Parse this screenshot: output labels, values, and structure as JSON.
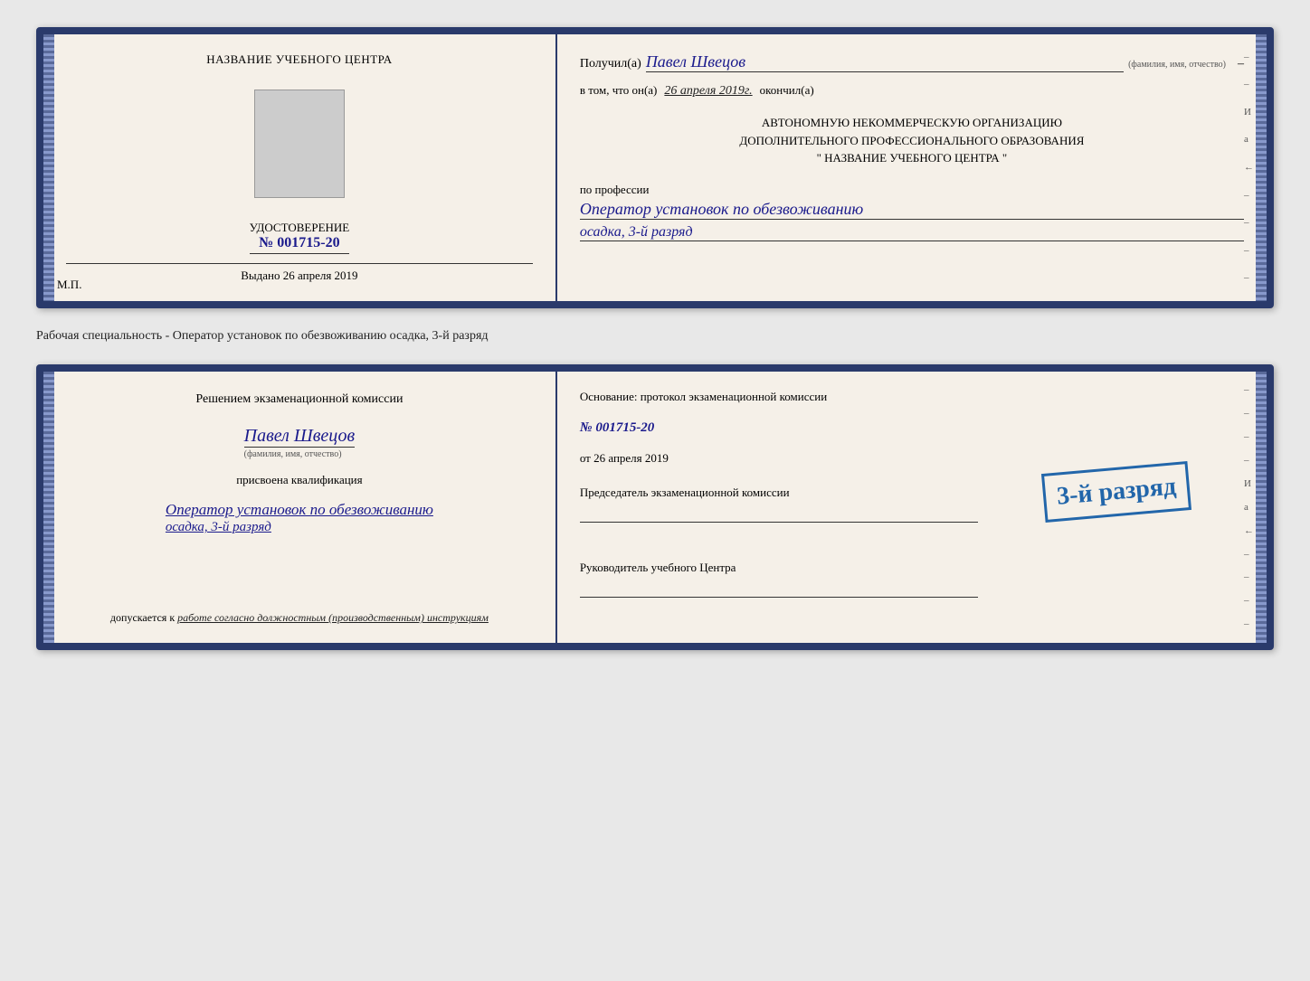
{
  "page": {
    "background": "#e8e8e8"
  },
  "top_document": {
    "left": {
      "title": "НАЗВАНИЕ УЧЕБНОГО ЦЕНТРА",
      "cert_label": "УДОСТОВЕРЕНИЕ",
      "cert_number_prefix": "№",
      "cert_number": "001715-20",
      "issued_label": "Выдано",
      "issued_date": "26 апреля 2019",
      "mp_label": "М.П."
    },
    "right": {
      "received_label": "Получил(а)",
      "recipient_name": "Павел Швецов",
      "fio_label": "(фамилия, имя, отчество)",
      "dash": "–",
      "in_that_label": "в том, что он(а)",
      "completion_date": "26 апреля 2019г.",
      "finished_label": "окончил(а)",
      "org_line1": "АВТОНОМНУЮ НЕКОММЕРЧЕСКУЮ ОРГАНИЗАЦИЮ",
      "org_line2": "ДОПОЛНИТЕЛЬНОГО ПРОФЕССИОНАЛЬНОГО ОБРАЗОВАНИЯ",
      "org_line3": "\"   НАЗВАНИЕ УЧЕБНОГО ЦЕНТРА   \"",
      "profession_label": "по профессии",
      "profession_line1": "Оператор установок по обезвоживанию",
      "profession_line2": "осадка, 3-й разряд"
    }
  },
  "separator": {
    "text": "Рабочая специальность - Оператор установок по обезвоживанию осадка, 3-й разряд"
  },
  "bottom_document": {
    "left": {
      "decision_label": "Решением экзаменационной комиссии",
      "person_name": "Павел Швецов",
      "fio_label": "(фамилия, имя, отчество)",
      "assigned_label": "присвоена квалификация",
      "qualification_line1": "Оператор установок по обезвоживанию",
      "qualification_line2": "осадка, 3-й разряд",
      "admitted_label": "допускается к",
      "admitted_text": "работе согласно должностным (производственным) инструкциям"
    },
    "right": {
      "basis_label": "Основание: протокол экзаменационной комиссии",
      "protocol_prefix": "№",
      "protocol_number": "001715-20",
      "date_prefix": "от",
      "protocol_date": "26 апреля 2019",
      "chairman_label": "Председатель экзаменационной комиссии",
      "stamp_text": "3-й разряд",
      "director_label": "Руководитель учебного Центра"
    }
  },
  "right_edge_marks": [
    "-",
    "-",
    "И",
    "a",
    "←",
    "-",
    "-",
    "-",
    "-"
  ]
}
